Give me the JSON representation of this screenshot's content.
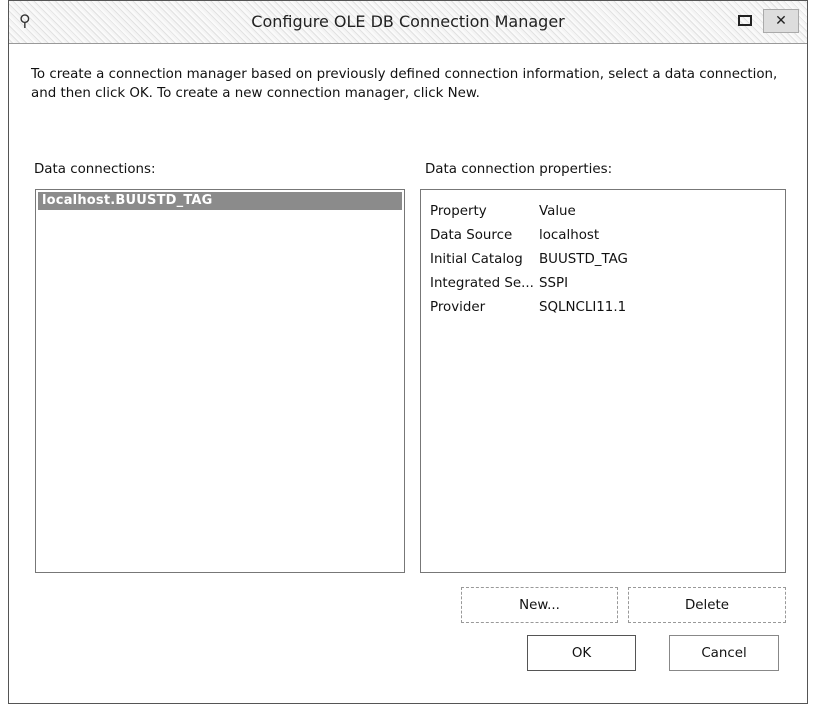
{
  "window": {
    "title": "Configure OLE DB Connection Manager"
  },
  "instructions": "To create a connection manager based on previously defined connection information, select a data connection, and then click OK. To create a new connection manager, click New.",
  "data_connections": {
    "label": "Data connections:",
    "items": [
      "localhost.BUUSTD_TAG"
    ]
  },
  "properties": {
    "label": "Data connection properties:",
    "header": {
      "property": "Property",
      "value": "Value"
    },
    "rows": [
      {
        "property": "Data Source",
        "value": "localhost"
      },
      {
        "property": "Initial Catalog",
        "value": "BUUSTD_TAG"
      },
      {
        "property": "Integrated Se...",
        "value": "SSPI"
      },
      {
        "property": "Provider",
        "value": "SQLNCLI11.1"
      }
    ]
  },
  "buttons": {
    "new": "New...",
    "delete": "Delete",
    "ok": "OK",
    "cancel": "Cancel"
  },
  "icons": {
    "app": "app-icon",
    "minimize": "minimize-icon",
    "close": "close-icon"
  }
}
